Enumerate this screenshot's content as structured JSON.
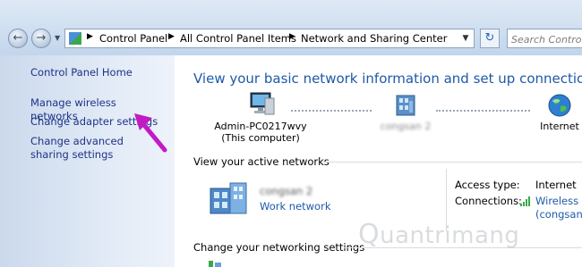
{
  "address_bar": {
    "crumbs": [
      "Control Panel",
      "All Control Panel Items",
      "Network and Sharing Center"
    ]
  },
  "search": {
    "placeholder": "Search Control P"
  },
  "left_pane": {
    "home": "Control Panel Home",
    "tasks": [
      "Manage wireless networks",
      "Change adapter settings",
      "Change advanced sharing settings"
    ]
  },
  "main": {
    "heading": "View your basic network information and set up connections",
    "map": {
      "computer_name": "Admin-PC0217wvy",
      "computer_caption": "(This computer)",
      "middle_label": "congsan 2",
      "internet_label": "Internet"
    },
    "active_networks": {
      "title": "View your active networks",
      "network_name": "congsan 2",
      "network_type": "Work network",
      "access_type_label": "Access type:",
      "access_type_value": "Internet",
      "connections_label": "Connections:",
      "connections_link_line1": "Wireless N",
      "connections_link_line2": "(congsan)"
    },
    "change_settings": {
      "title": "Change your networking settings"
    }
  },
  "watermark": "uantrimang",
  "colors": {
    "link": "#1e3287",
    "heading": "#1e5aa8",
    "annotation_arrow": "#c21bc6"
  }
}
